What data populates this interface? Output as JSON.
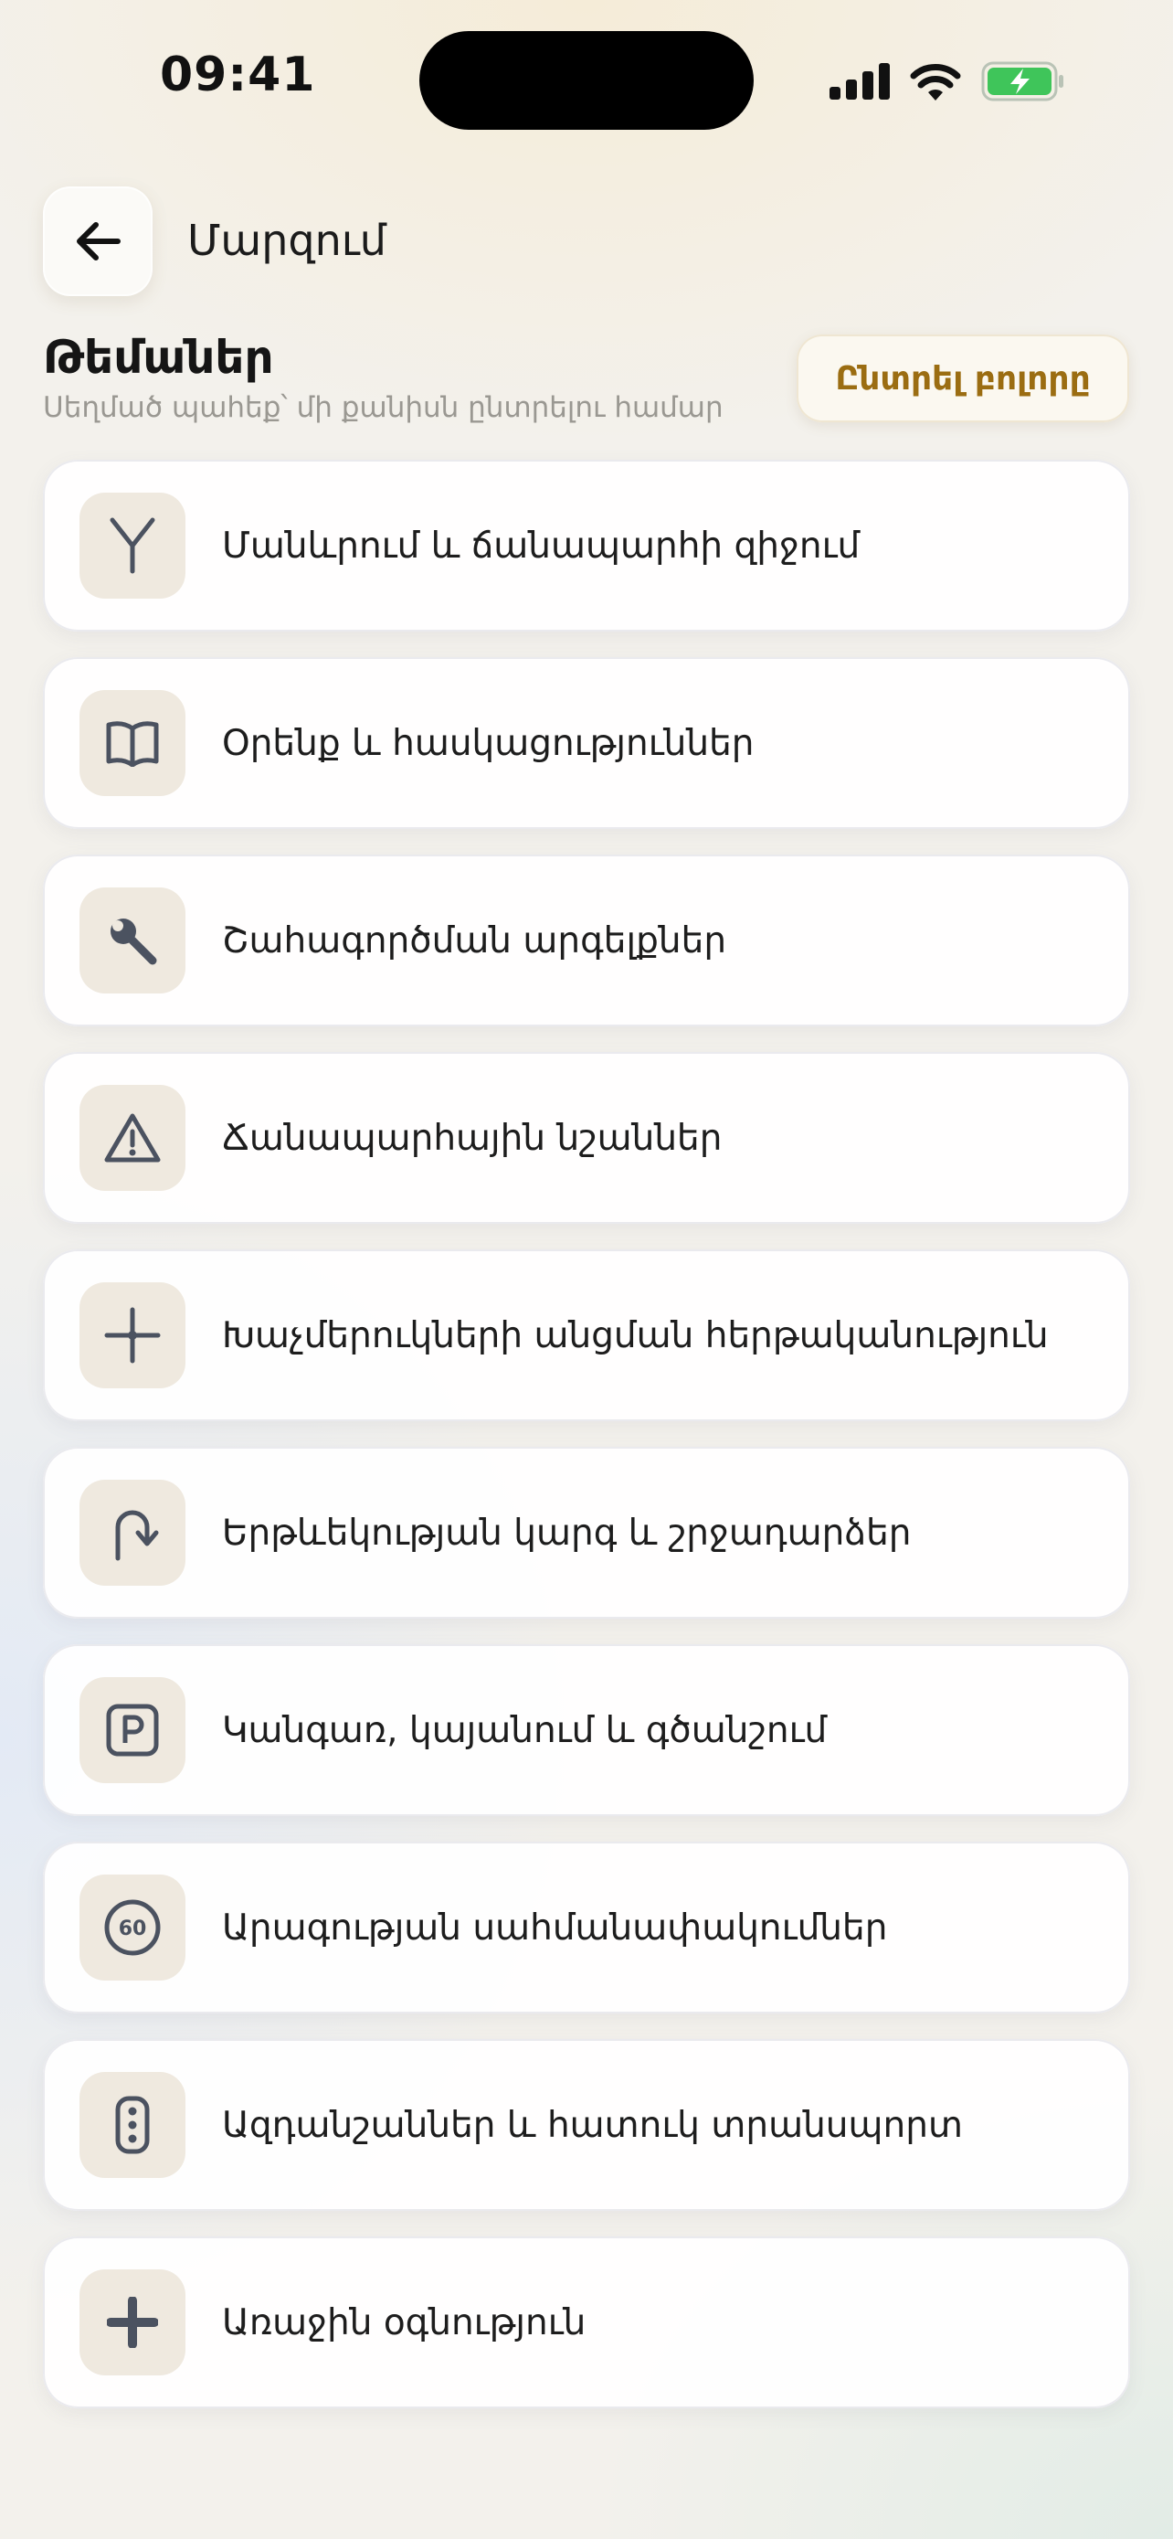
{
  "status_bar": {
    "time": "09:41"
  },
  "header": {
    "back_icon": "arrow-left-icon",
    "title": "Մարզում"
  },
  "section": {
    "title": "Թեմաներ",
    "subtitle": "Սեղմած պահեք՝ մի քանիսն ընտրելու համար",
    "select_all_label": "Ընտրել բոլորը"
  },
  "topics": [
    {
      "label": "Մանևրում և ճանապարհի զիջում",
      "icon": "fork-icon"
    },
    {
      "label": "Օրենք և հասկացություններ",
      "icon": "book-icon"
    },
    {
      "label": "Շահագործման արգելքներ",
      "icon": "wrench-icon"
    },
    {
      "label": "Ճանապարհային նշաններ",
      "icon": "warning-triangle-icon"
    },
    {
      "label": "Խաչմերուկների անցման հերթականություն",
      "icon": "crossroads-icon"
    },
    {
      "label": "Երթևեկության կարգ և շրջադարձեր",
      "icon": "u-turn-icon"
    },
    {
      "label": "Կանգառ, կայանում և գծանշում",
      "icon": "parking-icon"
    },
    {
      "label": "Արագության սահմանափակումներ",
      "icon": "speed-limit-icon",
      "icon_text": "60"
    },
    {
      "label": "Ազդանշաններ և հատուկ տրանսպորտ",
      "icon": "traffic-light-icon"
    },
    {
      "label": "Առաջին օգնություն",
      "icon": "plus-icon"
    }
  ],
  "colors": {
    "accent": "#9b6d12",
    "icon_bg": "#efe9df",
    "icon_stroke": "#4b5260",
    "battery_green": "#3fc55a"
  }
}
